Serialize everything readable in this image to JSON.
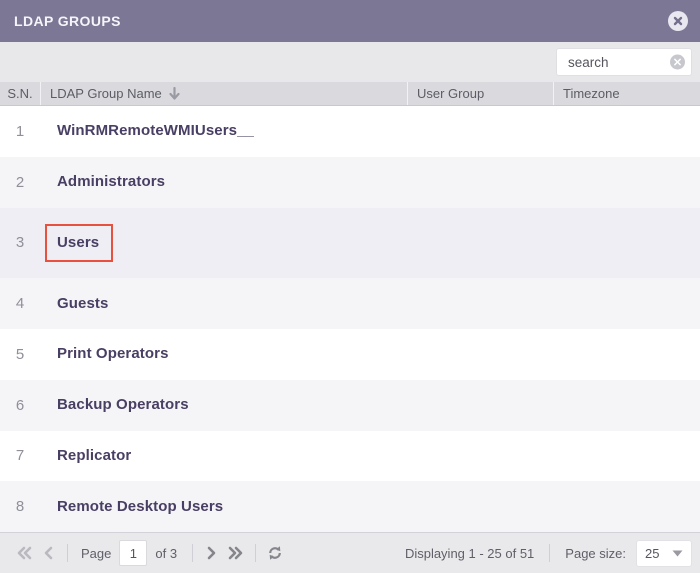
{
  "window": {
    "title": "LDAP GROUPS"
  },
  "icons": {
    "close": "close-icon",
    "search_clear": "clear-search-icon",
    "sort_desc": "sort-descending-arrow-icon",
    "refresh": "refresh-icon"
  },
  "search": {
    "placeholder": "search",
    "value": ""
  },
  "table": {
    "columns": [
      {
        "label": "S.N."
      },
      {
        "label": "LDAP Group Name",
        "sorted": "desc"
      },
      {
        "label": "User Group"
      },
      {
        "label": "Timezone"
      }
    ],
    "rows": [
      {
        "sn": "1",
        "name": "WinRMRemoteWMIUsers__",
        "user_group": "",
        "timezone": "",
        "highlighted": false
      },
      {
        "sn": "2",
        "name": "Administrators",
        "user_group": "",
        "timezone": "",
        "highlighted": false
      },
      {
        "sn": "3",
        "name": "Users",
        "user_group": "",
        "timezone": "",
        "highlighted": true
      },
      {
        "sn": "4",
        "name": "Guests",
        "user_group": "",
        "timezone": "",
        "highlighted": false
      },
      {
        "sn": "5",
        "name": "Print Operators",
        "user_group": "",
        "timezone": "",
        "highlighted": false
      },
      {
        "sn": "6",
        "name": "Backup Operators",
        "user_group": "",
        "timezone": "",
        "highlighted": false
      },
      {
        "sn": "7",
        "name": "Replicator",
        "user_group": "",
        "timezone": "",
        "highlighted": false
      },
      {
        "sn": "8",
        "name": "Remote Desktop Users",
        "user_group": "",
        "timezone": "",
        "highlighted": false
      }
    ]
  },
  "pagination": {
    "page_label": "Page",
    "current_page": "1",
    "of_label": "of 3",
    "displaying": "Displaying 1 - 25 of 51",
    "page_size_label": "Page size:",
    "page_size": "25"
  },
  "colors": {
    "titlebar_bg": "#7b7795",
    "toolbar_bg": "#e8e8eb",
    "table_header_bg": "#dadade",
    "row_alt_bg": "#f5f5f7",
    "row_selected_bg": "#efeef4",
    "group_name_text": "#493e63",
    "highlight_box_border": "#e8513e",
    "footer_bg": "#e9e9eb"
  }
}
